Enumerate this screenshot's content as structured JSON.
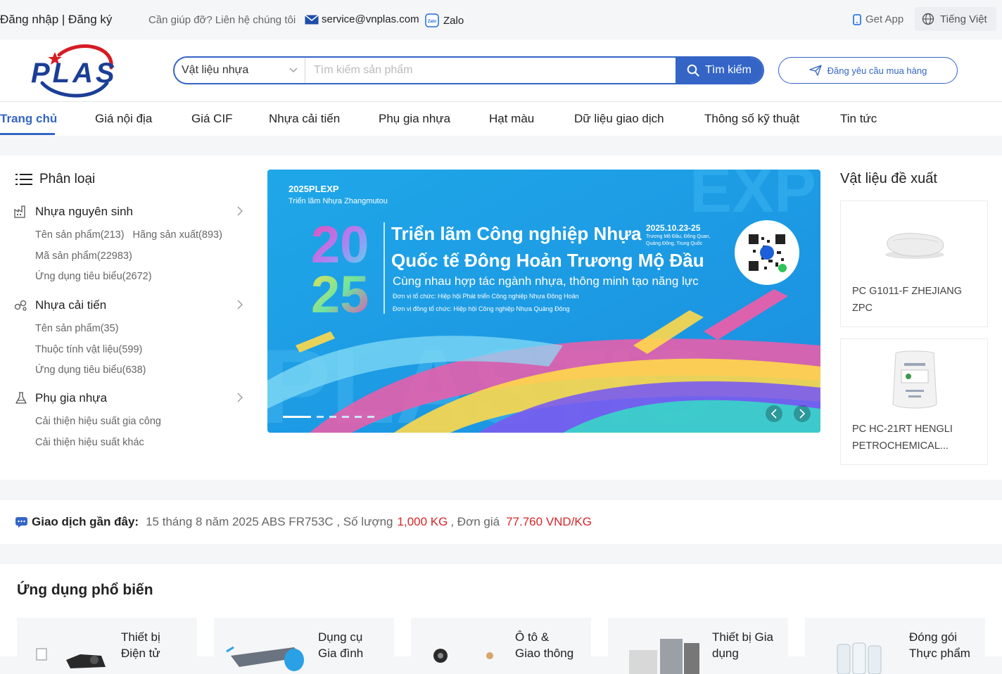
{
  "topbar": {
    "login": "Đăng nhập | Đăng ký",
    "help": "Cần giúp đỡ? Liên hệ chúng tôi",
    "email": "service@vnplas.com",
    "zalo": "Zalo",
    "get_app": "Get App",
    "language": "Tiếng Việt"
  },
  "header": {
    "search_category": "Vật liệu nhựa",
    "search_placeholder": "Tìm kiếm sản phẩm",
    "search_button": "Tìm kiếm",
    "rfq_button": "Đăng yêu cầu mua hàng"
  },
  "nav": {
    "items": [
      "Trang chủ",
      "Giá nội địa",
      "Giá CIF",
      "Nhựa cải tiến",
      "Phụ gia nhựa",
      "Hạt màu",
      "Dữ liệu giao dịch",
      "Thông số kỹ thuật",
      "Tin tức"
    ]
  },
  "categories": {
    "title": "Phân loại",
    "groups": [
      {
        "name": "Nhựa nguyên sinh",
        "links": [
          "Tên sản phẩm(213)",
          "Hãng sản xuất(893)",
          "Mã sản phẩm(22983)",
          "Ứng dụng tiêu biểu(2672)"
        ]
      },
      {
        "name": "Nhựa cải tiến",
        "links": [
          "Tên sản phẩm(35)",
          "Thuộc tính vật liệu(599)",
          "Ứng dụng tiêu biểu(638)"
        ]
      },
      {
        "name": "Phụ gia nhựa",
        "links": [
          "Cải thiện hiệu suất gia công",
          "Cải thiện hiệu suất khác"
        ]
      }
    ]
  },
  "banner": {
    "brand": "2025PLEXP",
    "subtitle": "Triển lãm Nhựa Zhangmutou",
    "year_top": "20",
    "year_bottom": "25",
    "headline1": "Triển lãm Công nghiệp Nhựa",
    "headline2": "Quốc tế Đông Hoản Trương Mộ Đầu",
    "date": "2025.10.23-25",
    "place1": "Trương Mộ Đầu, Đông Quan,",
    "place2": "Quảng Đông, Trung Quốc",
    "tagline": "Cùng nhau hợp tác ngành nhựa, thông minh tạo năng lực",
    "organizer": "Đơn vị tổ chức: Hiệp hội Phát triển Công nghiệp Nhựa Đông Hoản",
    "co_organizer": "Đơn vị đồng tổ chức: Hiệp hội Công nghiệp Nhựa Quảng Đông",
    "watermark": "PLASTIC"
  },
  "recommended": {
    "title": "Vật liệu đề xuất",
    "items": [
      {
        "name": "PC G1011-F ZHEJIANG ZPC"
      },
      {
        "name": "PC HC-21RT HENGLI PETROCHEMICAL..."
      }
    ]
  },
  "transaction": {
    "label": "Giao dịch gần đây:",
    "text": "15 tháng 8 năm 2025 ABS FR753C ,  Số lượng",
    "quantity": "1,000 KG",
    "price_label": ", Đơn giá",
    "price": "77.760 VND/KG"
  },
  "apps": {
    "title": "Ứng dụng phổ biến",
    "items": [
      {
        "line1": "Thiết bị",
        "line2": "Điện tử"
      },
      {
        "line1": "Dụng cụ",
        "line2": "Gia đình"
      },
      {
        "line1": "Ô tô &",
        "line2": "Giao thông"
      },
      {
        "line1": "Thiết bị Gia",
        "line2": "dụng"
      },
      {
        "line1": "Đóng gói",
        "line2": "Thực phẩm"
      }
    ]
  },
  "colors": {
    "accent": "#3465c6",
    "price_red": "#d6262a"
  }
}
